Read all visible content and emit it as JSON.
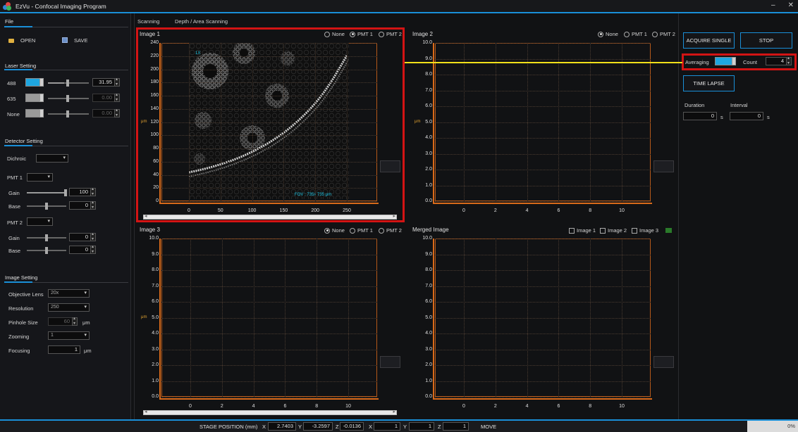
{
  "window": {
    "title": "EzVu - Confocal Imaging Program"
  },
  "tabs": [
    "Scanning",
    "Depth / Area Scanning"
  ],
  "file": {
    "section": "File",
    "open": "OPEN",
    "save": "SAVE"
  },
  "laser": {
    "section": "Laser Setting",
    "rows": [
      {
        "label": "488",
        "value": "31.95",
        "color": "#1ea6e0",
        "level": 0.6
      },
      {
        "label": "635",
        "value": "0.00",
        "color": "#a0a0a0",
        "level": 0.6
      },
      {
        "label": "None",
        "value": "0.00",
        "color": "#a0a0a0",
        "level": 0.6
      }
    ]
  },
  "detector": {
    "section": "Detector Setting",
    "dichroic_label": "Dichroic",
    "pmt1": {
      "label": "PMT 1",
      "gain_label": "Gain",
      "gain": "100",
      "base_label": "Base",
      "base": "0"
    },
    "pmt2": {
      "label": "PMT 2",
      "gain_label": "Gain",
      "gain": "0",
      "base_label": "Base",
      "base": "0"
    }
  },
  "image_setting": {
    "section": "Image Setting",
    "objective_label": "Objective Lens",
    "objective": "20x",
    "resolution_label": "Resolution",
    "resolution": "250",
    "pinhole_label": "Pinhole Size",
    "pinhole": "60",
    "pinhole_unit": "μm",
    "zoom_label": "Zooming",
    "zoom": "1",
    "focus_label": "Focusing",
    "focus": "1",
    "focus_unit": "μm"
  },
  "panels": {
    "image1": {
      "title": "Image 1",
      "radios": [
        "None",
        "PMT 1",
        "PMT 2"
      ],
      "selected": 1,
      "zoom_text": "1X",
      "fov_text": "FOV : 735x 735 μm",
      "unit": "μm"
    },
    "image2": {
      "title": "Image 2",
      "radios": [
        "None",
        "PMT 1",
        "PMT 2"
      ],
      "selected": 0,
      "unit": "μm"
    },
    "image3": {
      "title": "Image 3",
      "radios": [
        "None",
        "PMT 1",
        "PMT 2"
      ],
      "selected": 0,
      "unit": "μm"
    },
    "merged": {
      "title": "Merged Image",
      "checks": [
        "Image 1",
        "Image 2",
        "Image 3"
      ]
    }
  },
  "axes": {
    "image1": {
      "y": [
        "240",
        "220",
        "200",
        "180",
        "160",
        "140",
        "120",
        "100",
        "80",
        "60",
        "40",
        "20",
        "0"
      ],
      "x": [
        "0",
        "50",
        "100",
        "150",
        "200",
        "250"
      ]
    },
    "small": {
      "y": [
        "10.0",
        "9.0",
        "8.0",
        "7.0",
        "6.0",
        "5.0",
        "4.0",
        "3.0",
        "2.0",
        "1.0",
        "0.0"
      ],
      "x": [
        "0",
        "2",
        "4",
        "6",
        "8",
        "10"
      ]
    }
  },
  "right": {
    "acquire": "ACQUIRE SINGLE",
    "stop": "STOP",
    "averaging_label": "Averaging",
    "count_label": "Count",
    "count": "4",
    "time_lapse": "TIME LAPSE",
    "duration_label": "Duration",
    "duration": "0",
    "interval_label": "Interval",
    "interval": "0",
    "sec_unit": "s"
  },
  "status": {
    "stage_label": "STAGE POSITION (mm)",
    "x_label": "X",
    "x": "2.7403",
    "y_label": "Y",
    "y": "-3.2597",
    "z_label": "Z",
    "z": "-0.0136",
    "x2_label": "X",
    "x2": "1",
    "y2_label": "Y",
    "y2": "1",
    "z2_label": "Z",
    "z2": "1",
    "move": "MOVE",
    "progress": "0%"
  }
}
